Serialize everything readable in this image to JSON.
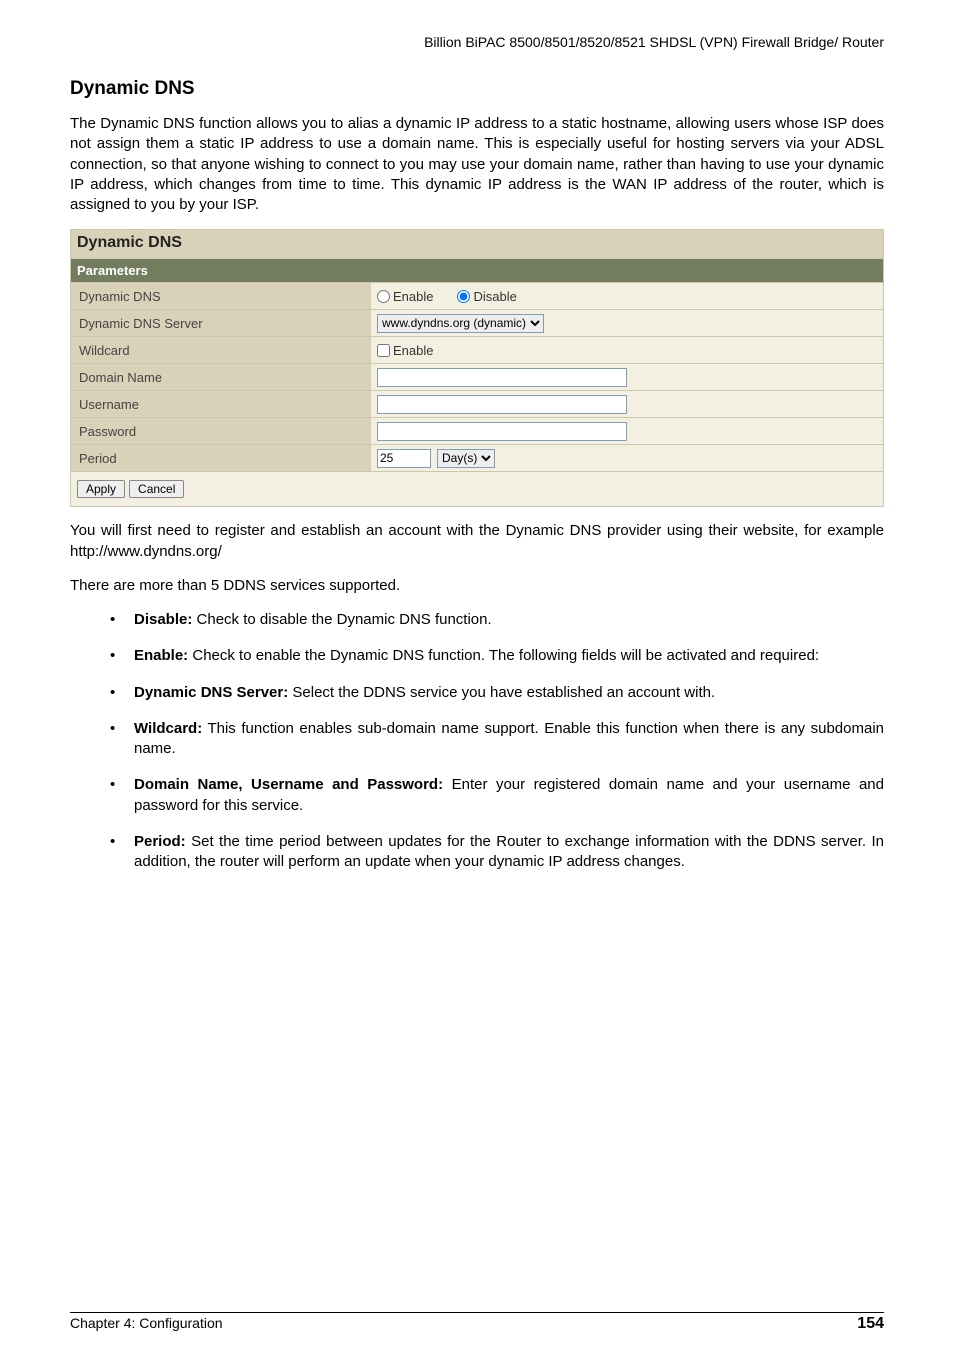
{
  "header": "Billion BiPAC 8500/8501/8520/8521 SHDSL (VPN) Firewall Bridge/ Router",
  "title": "Dynamic DNS",
  "intro": "The Dynamic DNS function allows you to alias a dynamic IP address to a static hostname, allowing users whose ISP does not assign them a static IP address to use a domain name. This is especially useful for hosting servers via your ADSL connection, so that anyone wishing to connect to you may use your domain name, rather than having to use your dynamic IP address, which changes from time to time. This dynamic IP address is the WAN IP address of the router, which is assigned to you by your ISP.",
  "panel": {
    "title": "Dynamic DNS",
    "subtitle": "Parameters",
    "rows": {
      "dyndns_label": "Dynamic DNS",
      "enable_label": "Enable",
      "disable_label": "Disable",
      "server_label": "Dynamic DNS Server",
      "server_value": "www.dyndns.org (dynamic)",
      "wildcard_label": "Wildcard",
      "wildcard_check": "Enable",
      "domain_label": "Domain Name",
      "username_label": "Username",
      "password_label": "Password",
      "period_label": "Period",
      "period_value": "25",
      "period_unit": "Day(s)"
    },
    "apply": "Apply",
    "cancel": "Cancel"
  },
  "after1": "You will first need to register and establish an account with the Dynamic DNS provider using their website, for example http://www.dyndns.org/",
  "after2": "There are more than 5 DDNS services supported.",
  "bullets": [
    {
      "b": "Disable:",
      "t": " Check to disable the Dynamic DNS function."
    },
    {
      "b": "Enable:",
      "t": " Check to enable the Dynamic DNS function. The following fields will be activated and required:"
    },
    {
      "b": "Dynamic DNS Server:",
      "t": " Select the DDNS service you have established an account with."
    },
    {
      "b": "Wildcard:",
      "t": " This function enables sub-domain name support. Enable this function when there is any subdomain name."
    },
    {
      "b": "Domain Name, Username and Password:",
      "t": " Enter your registered domain name and your username and password for this service."
    },
    {
      "b": "Period:",
      "t": " Set the time period between updates for the Router to exchange information with the DDNS server. In addition, the router will perform an update when your dynamic IP address changes."
    }
  ],
  "footer": {
    "chapter": "Chapter 4: Configuration",
    "page": "154"
  }
}
